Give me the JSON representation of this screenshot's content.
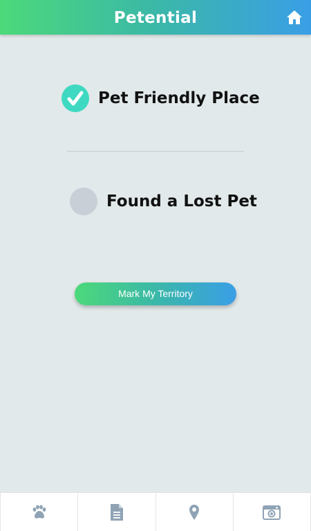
{
  "header": {
    "title": "Petential",
    "home_icon": "home-icon"
  },
  "options": [
    {
      "label": "Pet Friendly Place",
      "selected": true,
      "icon": "checkmark-icon"
    },
    {
      "label": "Found a Lost Pet",
      "selected": false
    }
  ],
  "action_button": {
    "label": "Mark My Territory"
  },
  "tabbar": {
    "items": [
      {
        "icon": "paw-icon"
      },
      {
        "icon": "document-icon"
      },
      {
        "icon": "map-pin-icon"
      },
      {
        "icon": "camera-icon"
      }
    ]
  },
  "colors": {
    "gradient_start": "#4cd97a",
    "gradient_mid": "#3bb8a8",
    "gradient_end": "#3a9ee6",
    "background": "#e2e9ea",
    "radio_selected": "#3fd9c2",
    "radio_unselected": "#c9cfd6",
    "tab_icon": "#8fa3b5"
  }
}
